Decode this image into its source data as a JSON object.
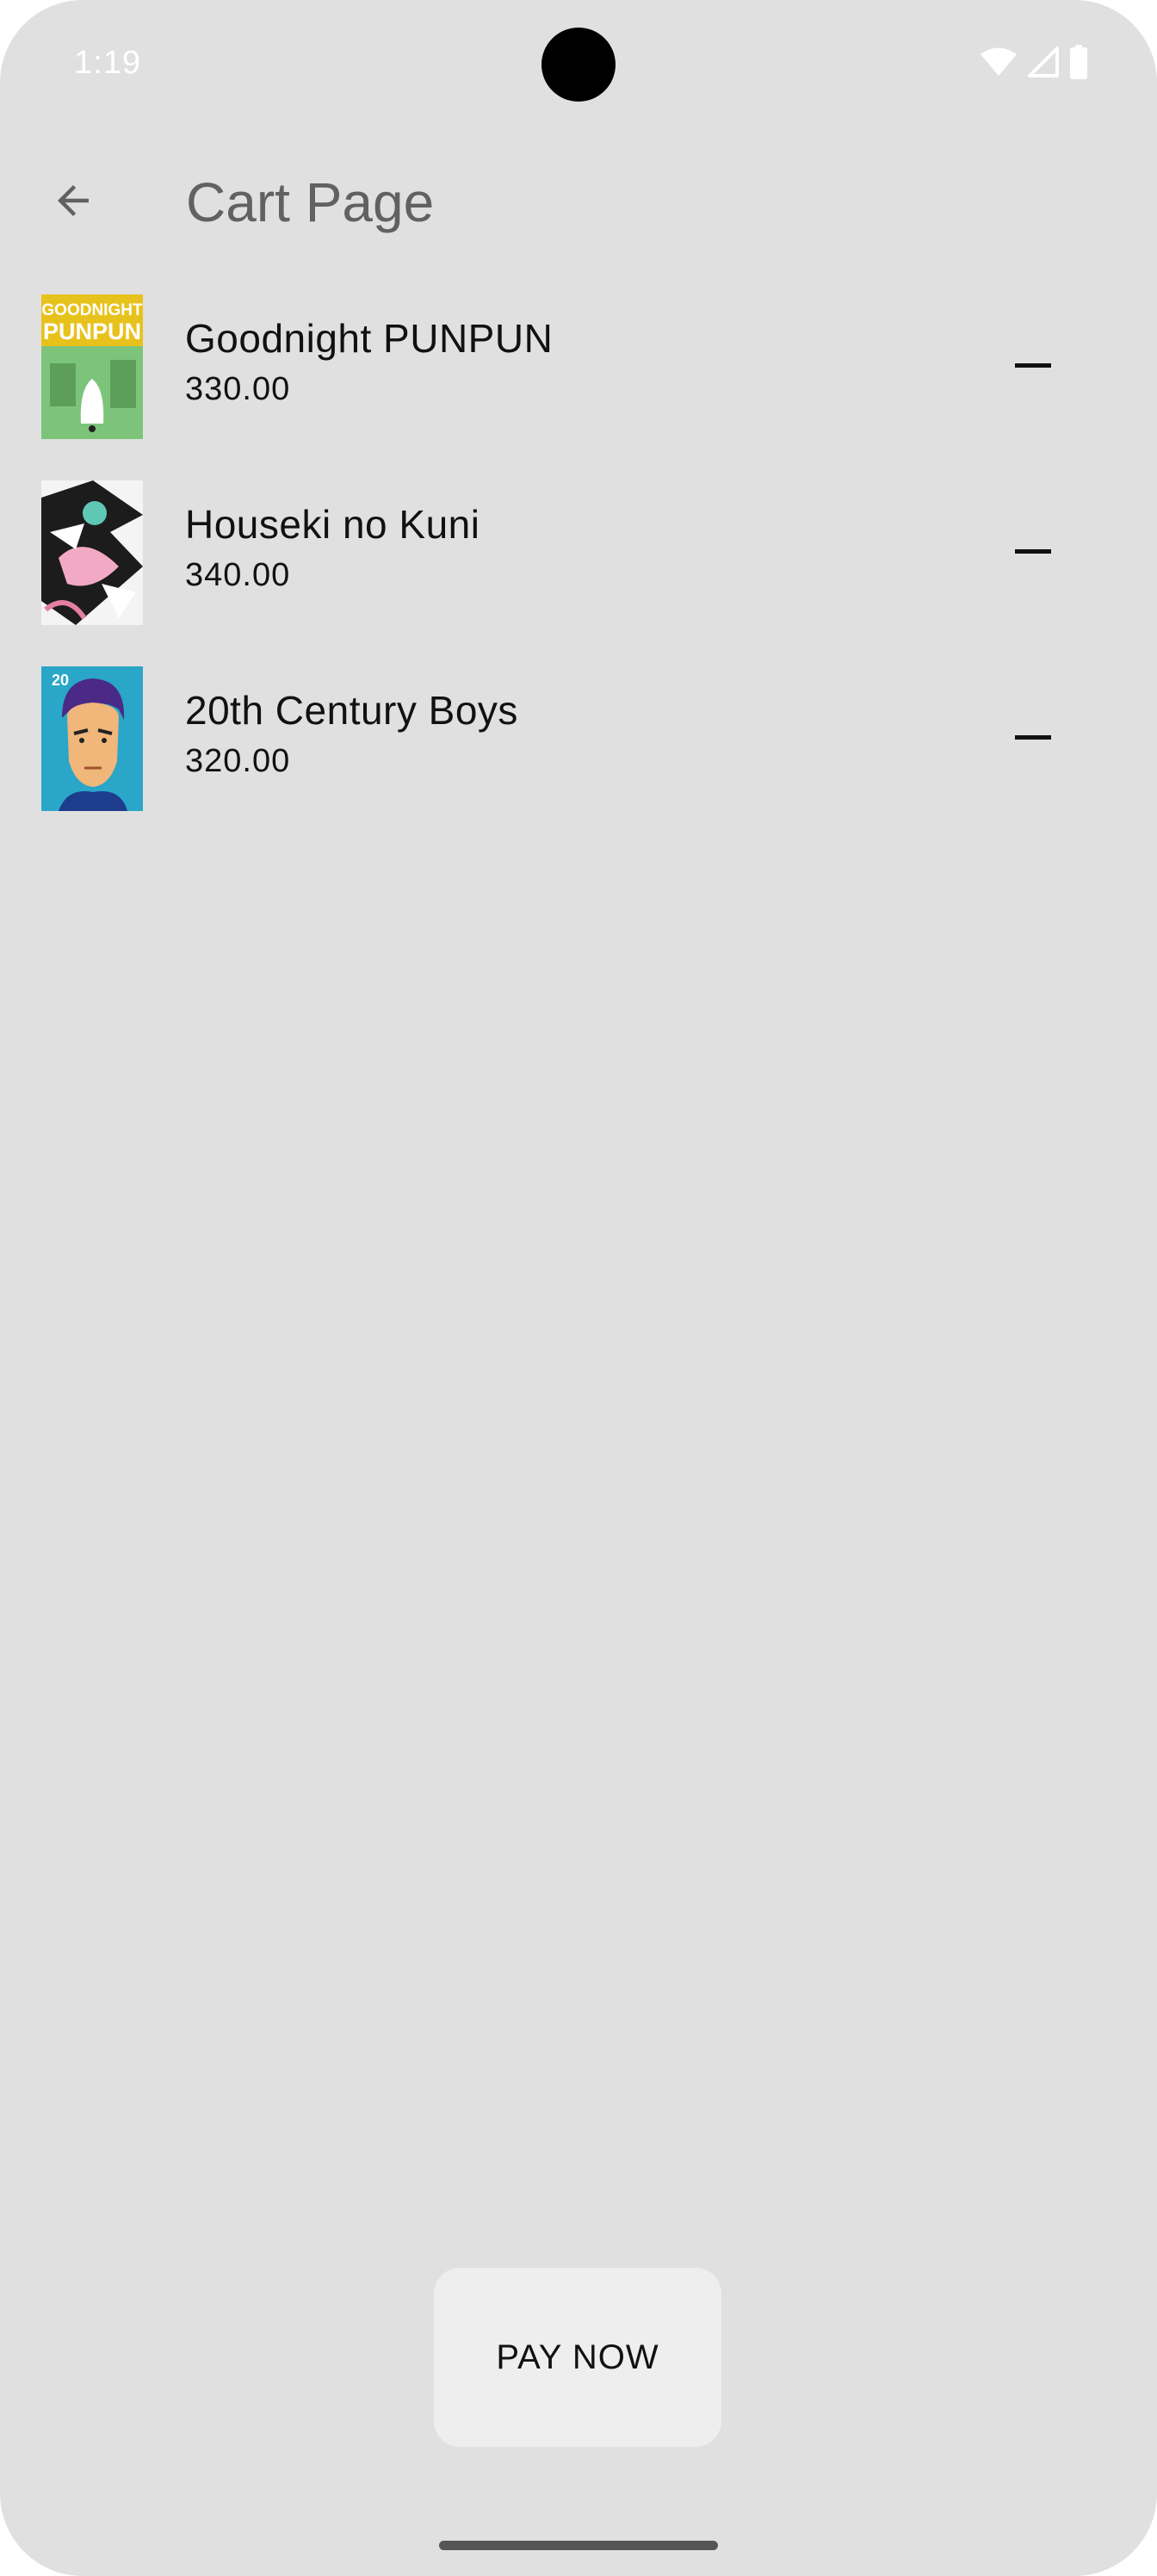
{
  "status_bar": {
    "time": "1:19",
    "icons": [
      "wifi-icon",
      "cellular-signal-icon",
      "battery-icon"
    ]
  },
  "app_bar": {
    "title": "Cart Page",
    "back_icon": "arrow-back-icon"
  },
  "cart": {
    "items": [
      {
        "title": "Goodnight PUNPUN",
        "price": "330.00",
        "cover_text": [
          "GOODNIGHT",
          "PUNPUN"
        ],
        "remove_icon": "remove-icon"
      },
      {
        "title": "Houseki no Kuni",
        "price": "340.00",
        "remove_icon": "remove-icon"
      },
      {
        "title": "20th Century Boys",
        "price": "320.00",
        "cover_text": [
          "20"
        ],
        "remove_icon": "remove-icon"
      }
    ]
  },
  "actions": {
    "pay_label": "PAY NOW"
  },
  "colors": {
    "background": "#e0e0e0",
    "title_text": "#616161",
    "button_bg": "#eeeeee"
  }
}
